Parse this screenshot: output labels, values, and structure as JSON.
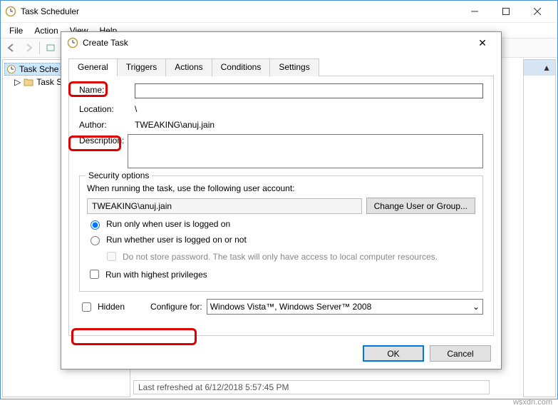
{
  "window": {
    "title": "Task Scheduler",
    "menus": [
      "File",
      "Action",
      "View",
      "Help"
    ],
    "tree_root": "Task Sche",
    "tree_child": "Task S",
    "status": "Last refreshed at 6/12/2018 5:57:45 PM"
  },
  "dialog": {
    "title": "Create Task",
    "tabs": [
      "General",
      "Triggers",
      "Actions",
      "Conditions",
      "Settings"
    ],
    "labels": {
      "name": "Name:",
      "location": "Location:",
      "author": "Author:",
      "description": "Description:"
    },
    "values": {
      "name": "",
      "location": "\\",
      "author": "TWEAKING\\anuj.jain",
      "description": ""
    },
    "security": {
      "legend": "Security options",
      "prompt": "When running the task, use the following user account:",
      "user": "TWEAKING\\anuj.jain",
      "change_btn": "Change User or Group...",
      "radio1": "Run only when user is logged on",
      "radio2": "Run whether user is logged on or not",
      "dnp": "Do not store password. The task will only have access to local computer resources.",
      "priv": "Run with highest privileges"
    },
    "bottom": {
      "hidden": "Hidden",
      "configure": "Configure for:",
      "configure_value": "Windows Vista™, Windows Server™ 2008"
    },
    "buttons": {
      "ok": "OK",
      "cancel": "Cancel"
    }
  },
  "watermark": "wsxdn.com"
}
